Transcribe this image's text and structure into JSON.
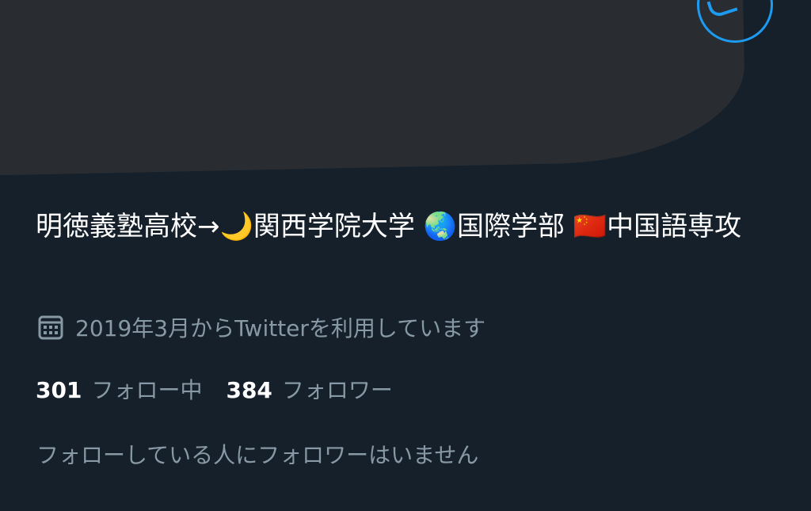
{
  "profile": {
    "bio": "明徳義塾高校→🌙関西学院大学 🌏国際学部 🇨🇳中国語専攻",
    "joined": "2019年3月からTwitterを利用しています",
    "following": {
      "count": "301",
      "label": "フォロー中"
    },
    "followers": {
      "count": "384",
      "label": "フォロワー"
    },
    "mutual_followers": "フォローしている人にフォロワーはいません"
  },
  "icons": {
    "joined": "calendar-icon",
    "top_right_button": "profile-action-icon"
  },
  "colors": {
    "background": "#15202b",
    "redaction": "#292d32",
    "accent": "#1d9bf0",
    "secondary_text": "#8899a6"
  }
}
